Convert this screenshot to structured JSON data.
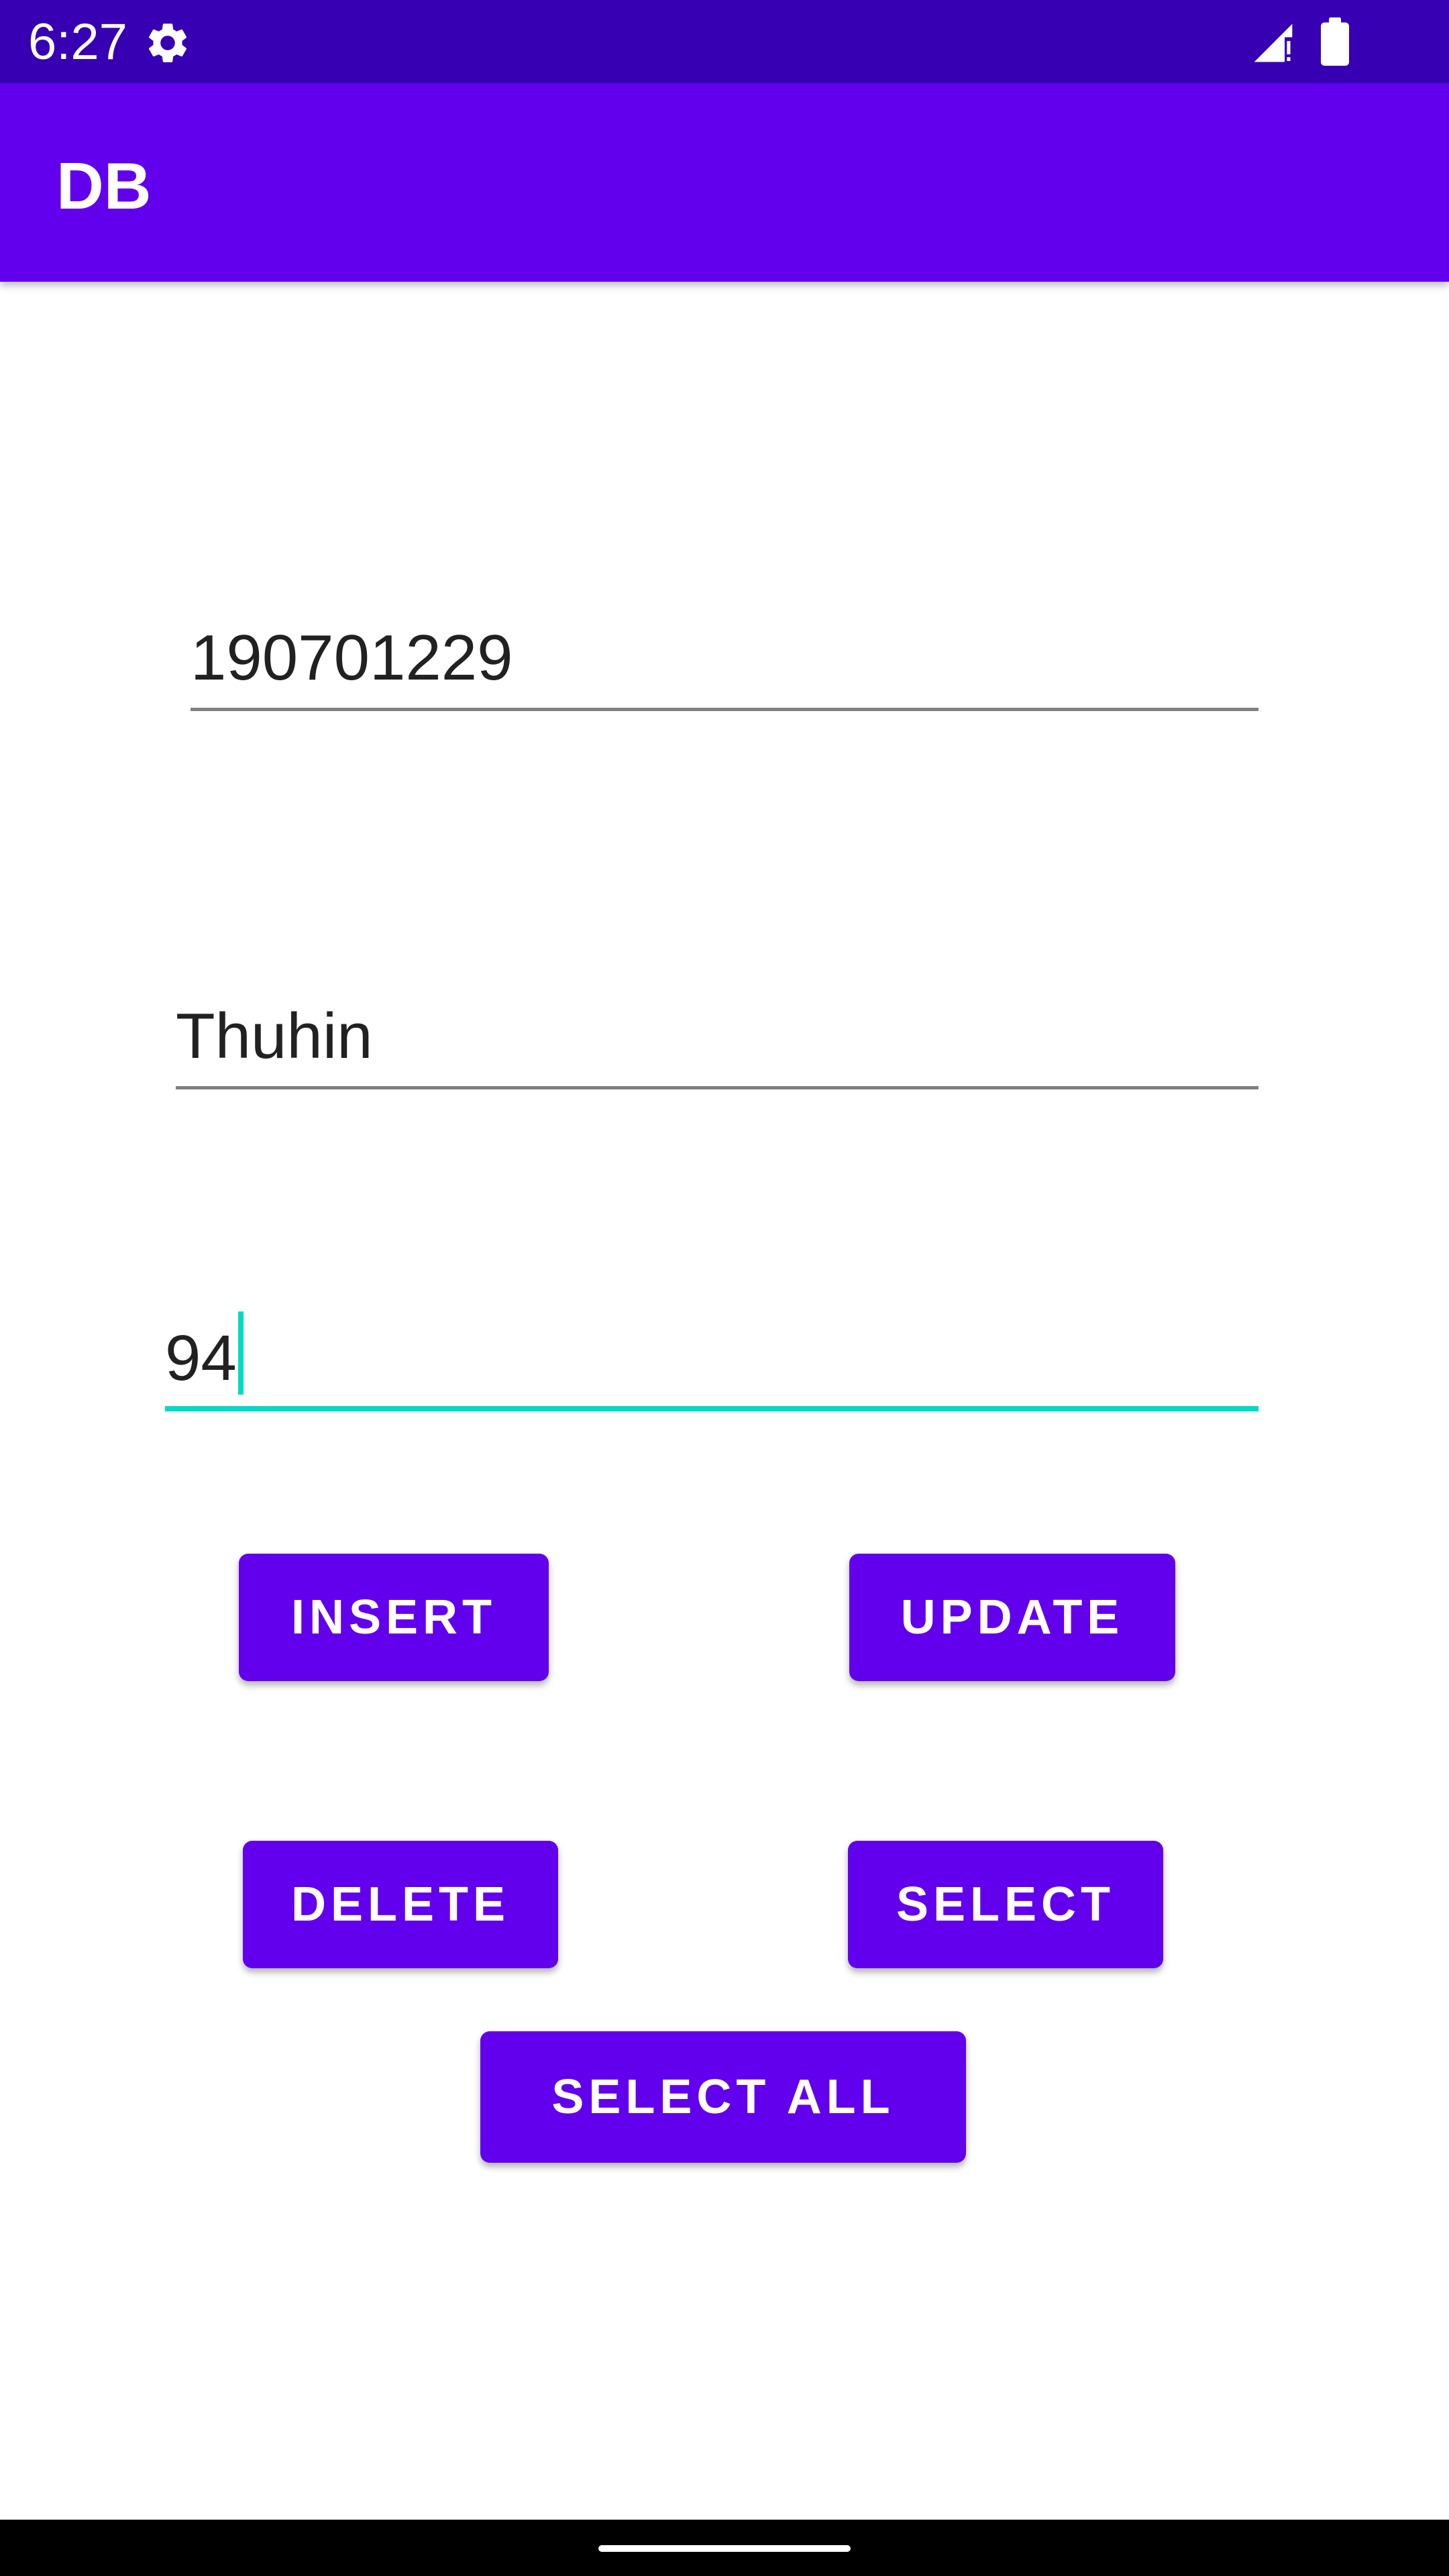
{
  "status_bar": {
    "time": "6:27",
    "icons": [
      "gear-icon",
      "signal-icon",
      "battery-icon"
    ],
    "background_color": "#3700B3"
  },
  "app_bar": {
    "title": "DB",
    "background_color": "#6200EE"
  },
  "form": {
    "id_field_value": "190701229",
    "name_field_value": "Thuhin",
    "marks_field_value": "94",
    "focus_color": "#03DAC5"
  },
  "buttons": {
    "insert": "INSERT",
    "update": "UPDATE",
    "delete": "DELETE",
    "select": "SELECT",
    "select_all": "SELECT ALL",
    "color": "#6200EE"
  }
}
